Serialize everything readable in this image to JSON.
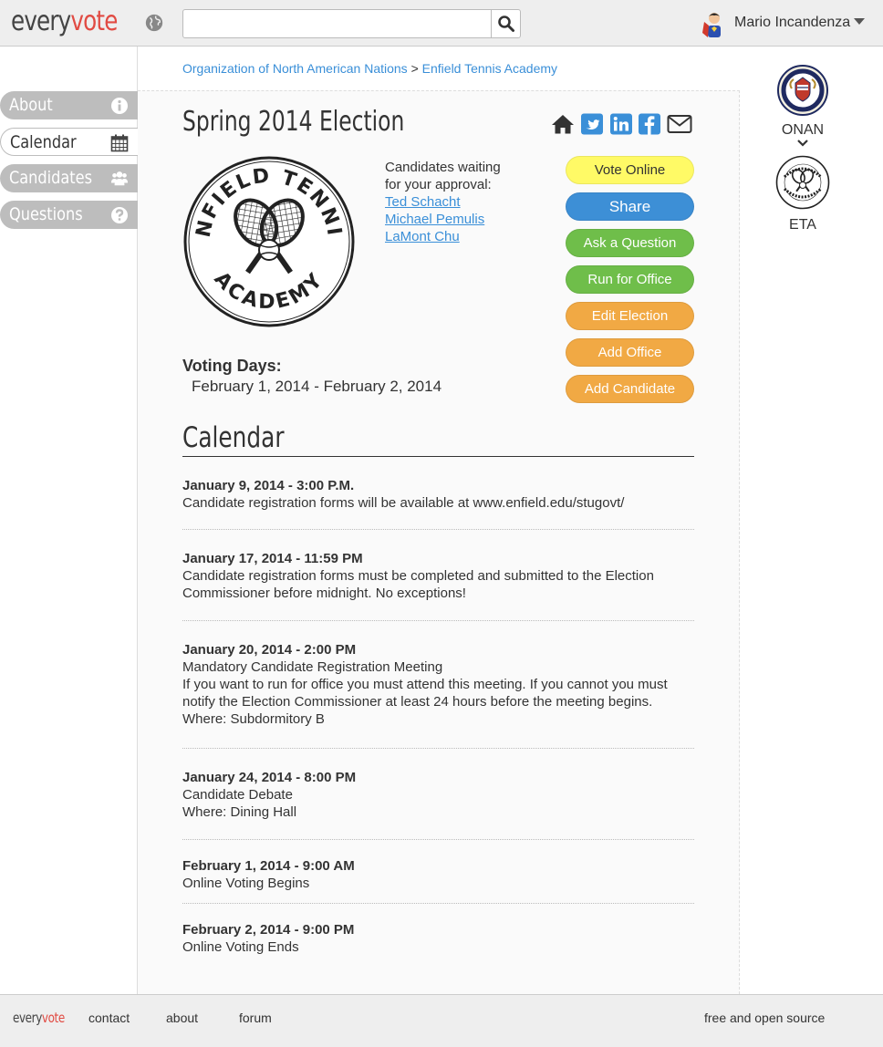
{
  "header": {
    "logo_part1": "every",
    "logo_part2": "vote",
    "search_placeholder": "",
    "user_name": "Mario Incandenza"
  },
  "nav": {
    "items": [
      {
        "label": "About",
        "icon": "info-icon",
        "active": false
      },
      {
        "label": "Calendar",
        "icon": "calendar-icon",
        "active": true
      },
      {
        "label": "Candidates",
        "icon": "users-icon",
        "active": false
      },
      {
        "label": "Questions",
        "icon": "question-icon",
        "active": false
      }
    ]
  },
  "breadcrumb": {
    "parent": "Organization of North American Nations",
    "separator": ">",
    "current": "Enfield Tennis Academy"
  },
  "election": {
    "title": "Spring 2014 Election",
    "share_icons": [
      "home-icon",
      "twitter-icon",
      "linkedin-icon",
      "facebook-icon",
      "envelope-icon"
    ],
    "logo_text_top": "ENFIELD TENNIS",
    "logo_text_bottom": "ACADEMY",
    "waiting_label_1": "Candidates waiting",
    "waiting_label_2": "for your approval:",
    "waiting_candidates": [
      "Ted Schacht",
      "Michael Pemulis",
      "LaMont Chu"
    ],
    "voting_days_label": "Voting Days:",
    "voting_days": "February 1, 2014 - February 2, 2014"
  },
  "actions": {
    "vote_online": "Vote Online",
    "share": "Share",
    "ask_question": "Ask a Question",
    "run_for_office": "Run for Office",
    "edit_election": "Edit Election",
    "add_office": "Add Office",
    "add_candidate": "Add Candidate"
  },
  "calendar": {
    "heading": "Calendar",
    "events": [
      {
        "when": "January 9, 2014 - 3:00 P.M.",
        "lines": [
          "Candidate registration forms will be available at www.enfield.edu/stugovt/"
        ]
      },
      {
        "when": "January 17, 2014 - 11:59 PM",
        "lines": [
          "Candidate registration forms must be completed and submitted to the Election Commissioner before midnight. No exceptions!"
        ]
      },
      {
        "when": "January 20, 2014 - 2:00 PM",
        "lines": [
          "Mandatory Candidate Registration Meeting",
          "If you want to run for office you must attend this meeting. If you cannot you must notify the Election Commissioner at least 24 hours before the meeting begins.",
          "Where: Subdormitory B"
        ]
      },
      {
        "when": "January 24, 2014 - 8:00 PM",
        "lines": [
          "Candidate Debate",
          "Where: Dining Hall"
        ]
      },
      {
        "when": "February 1, 2014 - 9:00 AM",
        "lines": [
          "Online Voting Begins"
        ]
      },
      {
        "when": "February 2, 2014 - 9:00 PM",
        "lines": [
          "Online Voting Ends"
        ]
      }
    ]
  },
  "orgs": [
    {
      "abbr": "ONAN",
      "icon": "onan-seal-icon"
    },
    {
      "abbr": "ETA",
      "icon": "eta-seal-icon"
    }
  ],
  "footer": {
    "logo_part1": "every",
    "logo_part2": "vote",
    "links": [
      "contact",
      "about",
      "forum"
    ],
    "right_text": "free and open source"
  },
  "colors": {
    "link": "#3a8fd8",
    "brand_red": "#e14b43",
    "yellow": "#fffa66",
    "blue": "#3d8fd6",
    "green": "#6fbe4a",
    "orange": "#f1a944"
  }
}
